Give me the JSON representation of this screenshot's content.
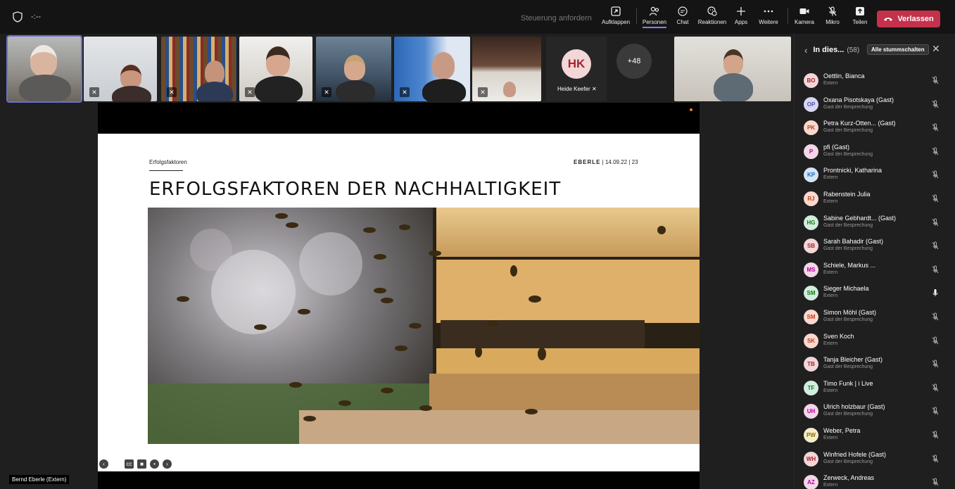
{
  "topbar": {
    "timer": "-:--",
    "control_request": "Steuerung anfordern",
    "items": [
      {
        "label": "Aufklappen",
        "icon": "popout-icon"
      },
      {
        "label": "Personen",
        "icon": "people-icon"
      },
      {
        "label": "Chat",
        "icon": "chat-icon"
      },
      {
        "label": "Reaktionen",
        "icon": "reactions-icon"
      },
      {
        "label": "Apps",
        "icon": "plus-icon"
      },
      {
        "label": "Weitere",
        "icon": "more-icon"
      },
      {
        "label": "Kamera",
        "icon": "camera-icon"
      },
      {
        "label": "Mikro",
        "icon": "mic-off-icon"
      },
      {
        "label": "Teilen",
        "icon": "share-icon"
      }
    ],
    "leave_label": "Verlassen",
    "accent": "#c4314b"
  },
  "strip": {
    "hk_initials": "HK",
    "hk_name": "Heide Keefer",
    "overflow_count": "+48"
  },
  "slide": {
    "section": "Erfolgsfaktoren",
    "brand": "EBERLE",
    "date": "14.09.22",
    "page": "23",
    "title": "ERFOLGSFAKTOREN DER NACHHALTIGKEIT"
  },
  "presenter_tag": "Bernd Eberle (Extern)",
  "panel": {
    "title": "In dies...",
    "count": "(58)",
    "mute_all": "Alle stummschalten",
    "participants": [
      {
        "initials": "BO",
        "name": "Oettlin, Bianca",
        "sub": "Extern",
        "bg": "#f3d6d8",
        "fg": "#a4262c",
        "mic": "off"
      },
      {
        "initials": "OP",
        "name": "Oxana Pisotskaya (Gast)",
        "sub": "Gast der Besprechung",
        "bg": "#d6d7f3",
        "fg": "#4f52b2",
        "mic": "off"
      },
      {
        "initials": "PK",
        "name": "Petra Kurz-Otten... (Gast)",
        "sub": "Gast der Besprechung",
        "bg": "#f8d8cf",
        "fg": "#c43e1c",
        "mic": "off"
      },
      {
        "initials": "P",
        "name": "pfi (Gast)",
        "sub": "Gast der Besprechung",
        "bg": "#f3d6e8",
        "fg": "#b4009e",
        "mic": "off"
      },
      {
        "initials": "KP",
        "name": "Prontnicki, Katharina",
        "sub": "Extern",
        "bg": "#d6e4f3",
        "fg": "#0f6cbd",
        "mic": "off"
      },
      {
        "initials": "RJ",
        "name": "Rabenstein Julia",
        "sub": "Extern",
        "bg": "#f8d8cf",
        "fg": "#c43e1c",
        "mic": "off"
      },
      {
        "initials": "HG",
        "name": "Sabine Gebhardt... (Gast)",
        "sub": "Gast der Besprechung",
        "bg": "#d3ece0",
        "fg": "#0e7a0d",
        "mic": "off"
      },
      {
        "initials": "SB",
        "name": "Sarah Bahadir (Gast)",
        "sub": "Gast der Besprechung",
        "bg": "#f3d6d8",
        "fg": "#a4262c",
        "mic": "off"
      },
      {
        "initials": "MS",
        "name": "Schiele, Markus ...",
        "sub": "Extern",
        "bg": "#f3d6e8",
        "fg": "#b4009e",
        "mic": "off"
      },
      {
        "initials": "SM",
        "name": "Sieger Michaela",
        "sub": "Extern",
        "bg": "#d3ece0",
        "fg": "#0e7a0d",
        "mic": "on"
      },
      {
        "initials": "SM",
        "name": "Simon Möhl (Gast)",
        "sub": "Gast der Besprechung",
        "bg": "#f8d8cf",
        "fg": "#c43e1c",
        "mic": "off"
      },
      {
        "initials": "SK",
        "name": "Sven Koch",
        "sub": "Extern",
        "bg": "#f8d8cf",
        "fg": "#c43e1c",
        "mic": "off"
      },
      {
        "initials": "TB",
        "name": "Tanja Bleicher (Gast)",
        "sub": "Gast der Besprechung",
        "bg": "#f3d6d8",
        "fg": "#a4262c",
        "mic": "off"
      },
      {
        "initials": "TF",
        "name": "Timo Funk | i Live",
        "sub": "Extern",
        "bg": "#d3ece0",
        "fg": "#0e7a0d",
        "mic": "off"
      },
      {
        "initials": "UH",
        "name": "Ulrich holzbaur (Gast)",
        "sub": "Gast der Besprechung",
        "bg": "#f3d6e8",
        "fg": "#b4009e",
        "mic": "off"
      },
      {
        "initials": "PW",
        "name": "Weber, Petra",
        "sub": "Extern",
        "bg": "#f5ecc8",
        "fg": "#8a6d00",
        "mic": "off"
      },
      {
        "initials": "WH",
        "name": "Winfried Hofele (Gast)",
        "sub": "Gast der Besprechung",
        "bg": "#f3d6d8",
        "fg": "#a4262c",
        "mic": "off"
      },
      {
        "initials": "AZ",
        "name": "Zerweck, Andreas",
        "sub": "Extern",
        "bg": "#f3d6e8",
        "fg": "#b4009e",
        "mic": "off"
      }
    ]
  }
}
